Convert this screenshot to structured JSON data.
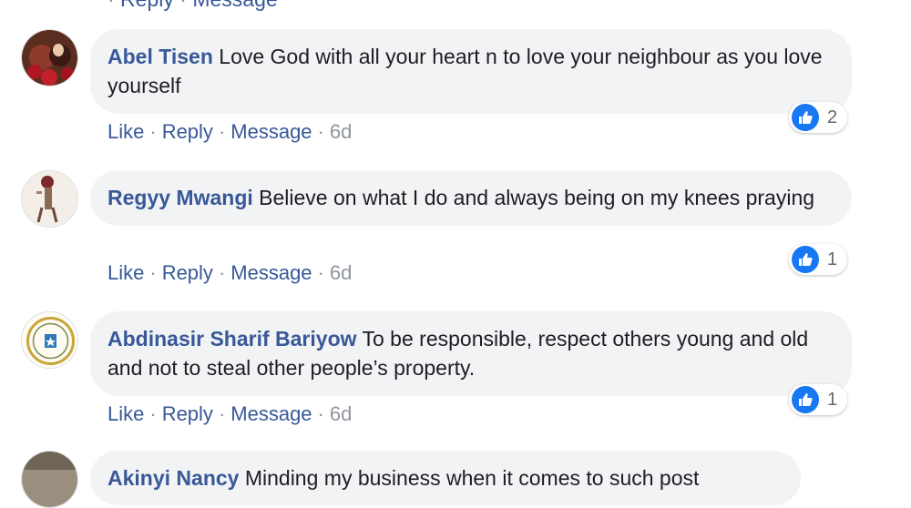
{
  "comments": [
    {
      "author": "Abel Tisen",
      "text": "Love God with all your heart n to love your neighbour as you love yourself",
      "actions": {
        "like": "Like",
        "reply": "Reply",
        "message": "Message",
        "time": "6d"
      },
      "reactions": "2",
      "reaction_icon": "like-icon",
      "avatar_colors": [
        "#5a2e1f",
        "#b01722",
        "#e8c9a8"
      ]
    },
    {
      "author": "Regyy Mwangi",
      "text": "Believe on what I do and always being on my knees praying",
      "actions": {
        "like": "Like",
        "reply": "Reply",
        "message": "Message",
        "time": "6d"
      },
      "reactions": "1",
      "reaction_icon": "like-icon",
      "avatar_colors": [
        "#f3efe8",
        "#8a6a55",
        "#7a2a2a"
      ]
    },
    {
      "author": "Abdinasir Sharif Bariyow",
      "text": "To be responsible, respect others young and old and not to steal other people’s property.",
      "actions": {
        "like": "Like",
        "reply": "Reply",
        "message": "Message",
        "time": "6d"
      },
      "reactions": "1",
      "reaction_icon": "like-icon",
      "avatar_colors": [
        "#fdfbf2",
        "#c9a43a",
        "#2d7ab8"
      ]
    }
  ],
  "partial_comment": {
    "author": "Akinyi Nancy",
    "text": "Minding my business when it comes to such post"
  },
  "colors": {
    "author": "#385898",
    "like_blue": "#1877f2",
    "bubble": "#f2f3f5"
  }
}
